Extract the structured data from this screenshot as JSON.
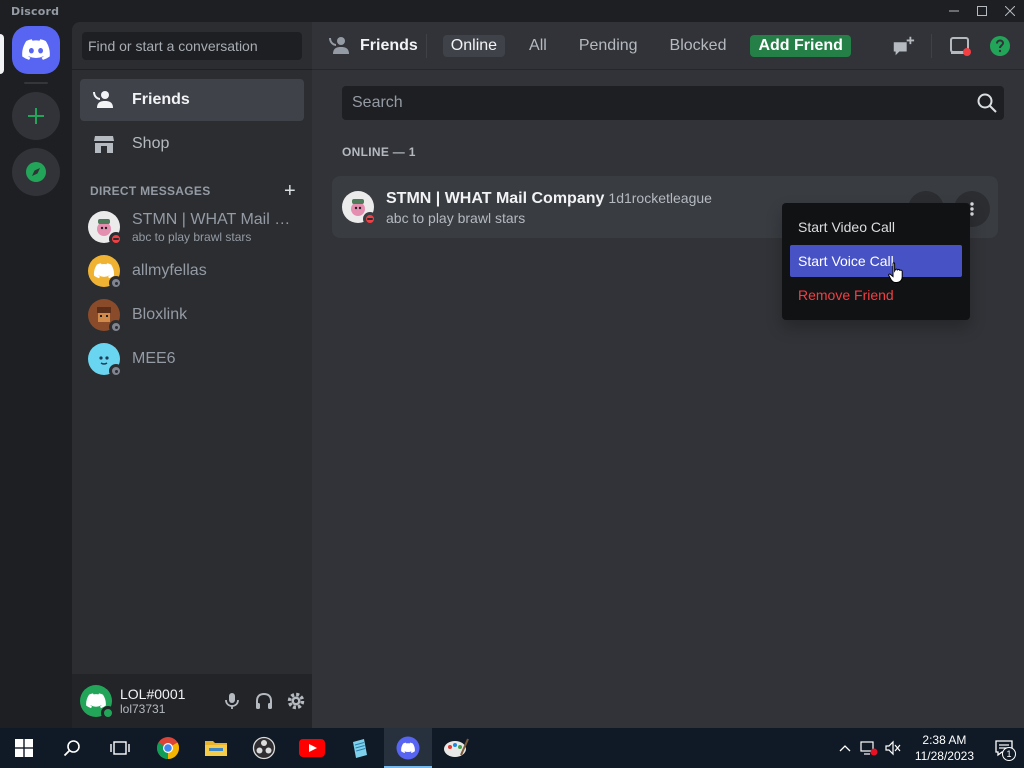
{
  "window": {
    "app_name": "Discord",
    "controls": [
      "minimize-icon",
      "maximize-icon",
      "close-icon"
    ]
  },
  "rail": {
    "home_icon": "discord-logo-icon",
    "add_icon": "plus-icon",
    "explore_icon": "compass-icon",
    "accent": "#5865f2",
    "green": "#23a559"
  },
  "sidebar": {
    "search_placeholder": "Find or start a conversation",
    "nav": [
      {
        "label": "Friends",
        "icon": "friends-icon"
      },
      {
        "label": "Shop",
        "icon": "shop-icon"
      }
    ],
    "dm_header": "DIRECT MESSAGES",
    "dm_add": "+",
    "dms": [
      {
        "name": "STMN | WHAT Mail Co...",
        "sub": "abc to play brawl stars",
        "status": "dnd",
        "avatar_color": "#ebebeb"
      },
      {
        "name": "allmyfellas",
        "sub": "",
        "status": "offline",
        "avatar_color": "#f0b232"
      },
      {
        "name": "Bloxlink",
        "sub": "",
        "status": "offline",
        "avatar_color": "#8a4b2a"
      },
      {
        "name": "MEE6",
        "sub": "",
        "status": "offline",
        "avatar_color": "#6ad5f0"
      }
    ]
  },
  "user_panel": {
    "name": "LOL#0001",
    "tag": "lol73731",
    "icons": [
      "microphone-icon",
      "headphones-icon",
      "settings-gear-icon"
    ]
  },
  "topbar": {
    "title": "Friends",
    "tabs": [
      {
        "label": "Online",
        "selected": true
      },
      {
        "label": "All",
        "selected": false
      },
      {
        "label": "Pending",
        "selected": false
      },
      {
        "label": "Blocked",
        "selected": false
      }
    ],
    "add_friend": "Add Friend",
    "right_icons": [
      "new-group-dm-icon",
      "inbox-icon",
      "help-icon"
    ]
  },
  "main": {
    "search_placeholder": "Search",
    "online_header": "ONLINE — 1",
    "friend": {
      "display_name": "STMN | WHAT Mail Company",
      "username": "1d1rocketleague",
      "status_text": "abc to play brawl stars",
      "status": "dnd"
    }
  },
  "context_menu": {
    "items": [
      {
        "label": "Start Video Call",
        "state": "normal"
      },
      {
        "label": "Start Voice Call",
        "state": "hover"
      },
      {
        "label": "Remove Friend",
        "state": "danger"
      }
    ]
  },
  "taskbar": {
    "apps": [
      "windows-start-icon",
      "search-icon",
      "task-view-icon",
      "chrome-icon",
      "file-explorer-icon",
      "obs-icon",
      "youtube-icon",
      "notepad-icon",
      "discord-icon",
      "paint-icon"
    ],
    "active_app": "discord-icon",
    "time": "2:38 AM",
    "date": "11/28/2023",
    "notification_count": "1"
  }
}
